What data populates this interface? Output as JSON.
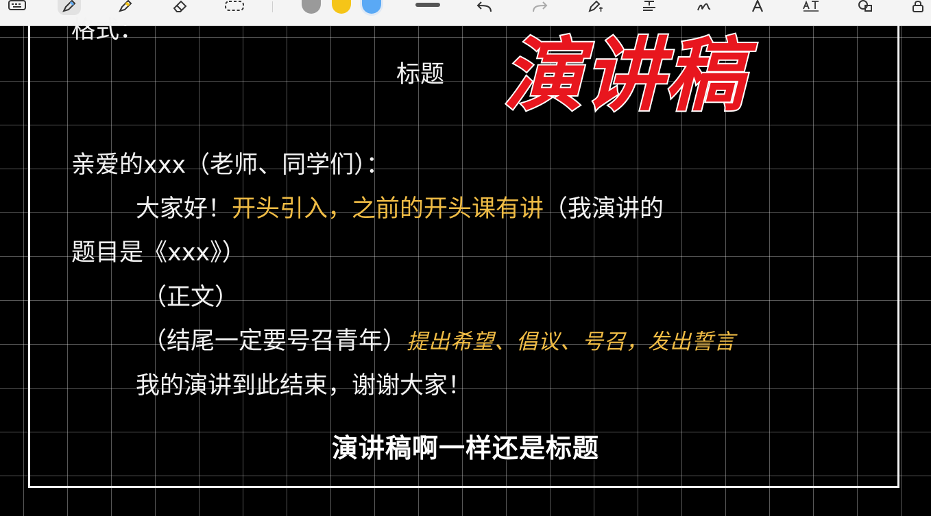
{
  "toolbar": {
    "tools": [
      {
        "name": "keyboard-icon",
        "active": false
      },
      {
        "name": "pen-icon",
        "active": true
      },
      {
        "name": "highlighter-icon",
        "active": false
      },
      {
        "name": "eraser-icon",
        "active": false
      },
      {
        "name": "lasso-select-icon",
        "active": false
      }
    ],
    "colors": [
      "#9a9a9a",
      "#f5c518",
      "#5aa9f5"
    ],
    "selected_color": "#5aa9f5",
    "right_tools": [
      "undo-icon",
      "redo-icon",
      "pen-settings-icon",
      "text-format-icon",
      "handwriting-icon",
      "text-style-icon",
      "text-size-icon",
      "shapes-icon",
      "lock-icon"
    ]
  },
  "canvas": {
    "big_title": "演讲稿",
    "format_label": "格式：",
    "heading_label": "标题",
    "greeting": "亲爱的xxx（老师、同学们）：",
    "line_intro": {
      "prefix": "大家好！",
      "highlight": "开头引入，之前的开头课有讲",
      "suffix": "（我演讲的"
    },
    "line_topic": "题目是《xxx》）",
    "line_body": "（正文）",
    "line_ending": {
      "text": "（结尾一定要号召青年）",
      "handwritten_note": "提出希望、倡议、号召，发出誓言"
    },
    "line_closing": "我的演讲到此结束，谢谢大家！"
  },
  "subtitle": "演讲稿啊一样还是标题",
  "colors": {
    "background": "#000000",
    "grid": "#ffffff",
    "highlight": "#f0bc45",
    "title_red": "#e8161e"
  }
}
